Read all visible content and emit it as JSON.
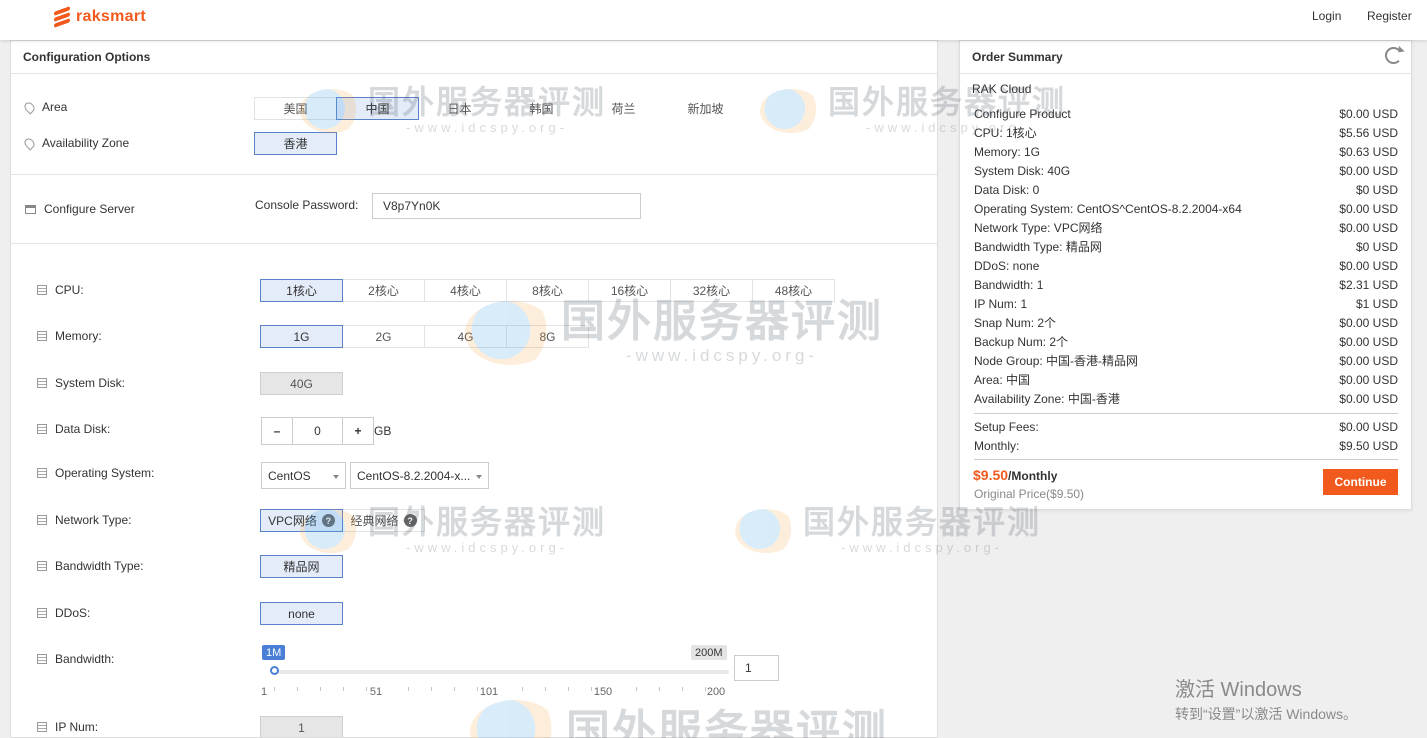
{
  "header": {
    "brand": "raksmart",
    "login": "Login",
    "register": "Register"
  },
  "config": {
    "title": "Configuration Options",
    "area": {
      "label": "Area",
      "options": [
        "美国",
        "中国",
        "日本",
        "韩国",
        "荷兰",
        "新加坡"
      ],
      "selected": "中国"
    },
    "zone": {
      "label": "Availability Zone",
      "options": [
        "香港"
      ],
      "selected": "香港"
    },
    "server": {
      "label": "Configure Server",
      "password_label": "Console Password:",
      "password_value": "V8p7Yn0K"
    },
    "cpu": {
      "label": "CPU:",
      "options": [
        "1核心",
        "2核心",
        "4核心",
        "8核心",
        "16核心",
        "32核心",
        "48核心"
      ],
      "selected": "1核心"
    },
    "memory": {
      "label": "Memory:",
      "options": [
        "1G",
        "2G",
        "4G",
        "8G"
      ],
      "selected": "1G"
    },
    "system_disk": {
      "label": "System Disk:",
      "value": "40G"
    },
    "data_disk": {
      "label": "Data Disk:",
      "minus": "–",
      "value": "0",
      "plus": "+",
      "unit": "GB"
    },
    "os": {
      "label": "Operating System:",
      "family": "CentOS",
      "version": "CentOS-8.2.2004-x..."
    },
    "network": {
      "label": "Network Type:",
      "options": [
        "VPC网络",
        "经典网络"
      ],
      "selected": "VPC网络",
      "help": "?"
    },
    "bandwidth_type": {
      "label": "Bandwidth Type:",
      "value": "精品网"
    },
    "ddos": {
      "label": "DDoS:",
      "value": "none"
    },
    "bandwidth": {
      "label": "Bandwidth:",
      "min_tag": "1M",
      "max_tag": "200M",
      "value": "1",
      "level": 0,
      "scale": [
        "1",
        "51",
        "101",
        "150",
        "200"
      ]
    },
    "ip_num": {
      "label": "IP Num:",
      "value": "1"
    }
  },
  "summary": {
    "title": "Order Summary",
    "product": "RAK Cloud",
    "rows": [
      {
        "label": "Configure Product",
        "price": "$0.00 USD"
      },
      {
        "label": "CPU: 1核心",
        "price": "$5.56 USD"
      },
      {
        "label": "Memory: 1G",
        "price": "$0.63 USD"
      },
      {
        "label": "System Disk: 40G",
        "price": "$0.00 USD"
      },
      {
        "label": "Data Disk: 0",
        "price": "$0 USD"
      },
      {
        "label": "Operating System: CentOS^CentOS-8.2.2004-x64",
        "price": "$0.00 USD"
      },
      {
        "label": "Network Type: VPC网络",
        "price": "$0.00 USD"
      },
      {
        "label": "Bandwidth Type: 精品网",
        "price": "$0 USD"
      },
      {
        "label": "DDoS: none",
        "price": "$0.00 USD"
      },
      {
        "label": "Bandwidth: 1",
        "price": "$2.31 USD"
      },
      {
        "label": "IP Num: 1",
        "price": "$1 USD"
      },
      {
        "label": "Snap Num: 2个",
        "price": "$0.00 USD"
      },
      {
        "label": "Backup Num: 2个",
        "price": "$0.00 USD"
      },
      {
        "label": "Node Group: 中国-香港-精品网",
        "price": "$0.00 USD"
      },
      {
        "label": "Area: 中国",
        "price": "$0.00 USD"
      },
      {
        "label": "Availability Zone: 中国-香港",
        "price": "$0.00 USD"
      }
    ],
    "setup_label": "Setup Fees:",
    "setup_price": "$0.00 USD",
    "monthly_label": "Monthly:",
    "monthly_price": "$9.50 USD",
    "total_amount": "$9.50",
    "total_suffix": "/Monthly",
    "original_price": "Original Price($9.50)",
    "continue": "Continue"
  },
  "watermark": {
    "title": "国外服务器评测",
    "url": "-www.idcspy.org-"
  },
  "windows": {
    "line1": "激活 Windows",
    "line2": "转到“设置”以激活 Windows。"
  }
}
